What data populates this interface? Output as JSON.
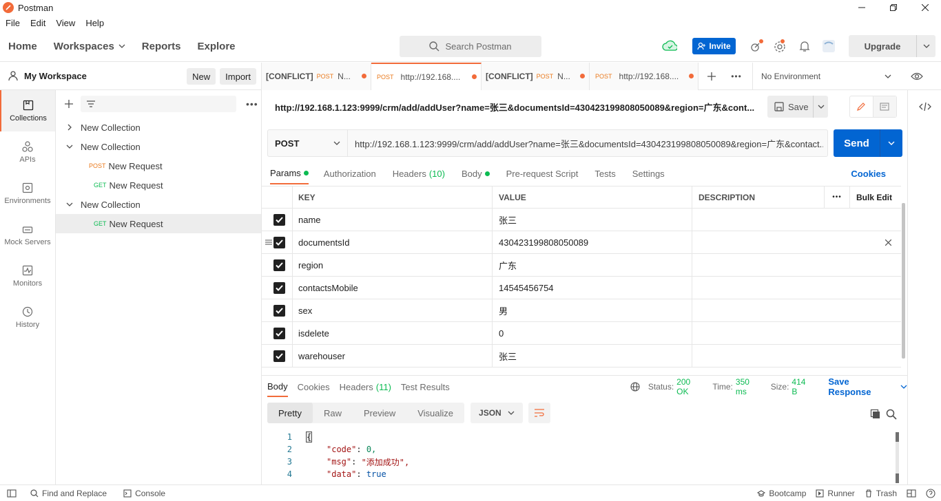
{
  "window": {
    "title": "Postman"
  },
  "menu": [
    "File",
    "Edit",
    "View",
    "Help"
  ],
  "header": {
    "nav": {
      "home": "Home",
      "workspaces": "Workspaces",
      "reports": "Reports",
      "explore": "Explore"
    },
    "search_placeholder": "Search Postman",
    "invite": "Invite",
    "upgrade": "Upgrade"
  },
  "workspace": {
    "name": "My Workspace",
    "new_btn": "New",
    "import_btn": "Import"
  },
  "rail": [
    {
      "label": "Collections",
      "icon": "collections-icon"
    },
    {
      "label": "APIs",
      "icon": "apis-icon"
    },
    {
      "label": "Environments",
      "icon": "environments-icon"
    },
    {
      "label": "Mock Servers",
      "icon": "mock-servers-icon"
    },
    {
      "label": "Monitors",
      "icon": "monitors-icon"
    },
    {
      "label": "History",
      "icon": "history-icon"
    }
  ],
  "tree": {
    "c1": "New Collection",
    "c2": "New Collection",
    "r1_method": "POST",
    "r1_name": "New Request",
    "r2_method": "GET",
    "r2_name": "New Request",
    "c3": "New Collection",
    "r3_method": "GET",
    "r3_name": "New Request"
  },
  "tabs": [
    {
      "prefix": "[CONFLICT]",
      "method": "POST",
      "name": "N..."
    },
    {
      "prefix": "",
      "method": "POST",
      "name": "http://192.168...."
    },
    {
      "prefix": "[CONFLICT]",
      "method": "POST",
      "name": "N..."
    },
    {
      "prefix": "",
      "method": "POST",
      "name": "http://192.168...."
    }
  ],
  "environment": "No Environment",
  "request": {
    "title": "http://192.168.1.123:9999/crm/add/addUser?name=张三&documentsId=430423199808050089&region=广东&cont...",
    "save": "Save",
    "method": "POST",
    "url": "http://192.168.1.123:9999/crm/add/addUser?name=张三&documentsId=430423199808050089&region=广东&contact...",
    "send": "Send"
  },
  "subtabs": {
    "params": "Params",
    "authorization": "Authorization",
    "headers": "Headers",
    "headers_count": "(10)",
    "body": "Body",
    "prerequest": "Pre-request Script",
    "tests": "Tests",
    "settings": "Settings",
    "cookies": "Cookies"
  },
  "params": {
    "headers": {
      "key": "KEY",
      "value": "VALUE",
      "description": "DESCRIPTION",
      "bulk": "Bulk Edit"
    },
    "rows": [
      {
        "key": "name",
        "value": "张三"
      },
      {
        "key": "documentsId",
        "value": "430423199808050089"
      },
      {
        "key": "region",
        "value": "广东"
      },
      {
        "key": "contactsMobile",
        "value": "14545456754"
      },
      {
        "key": "sex",
        "value": "男"
      },
      {
        "key": "isdelete",
        "value": "0"
      },
      {
        "key": "warehouser",
        "value": "张三"
      }
    ]
  },
  "response": {
    "tabs": {
      "body": "Body",
      "cookies": "Cookies",
      "headers": "Headers",
      "headers_count": "(11)",
      "tests": "Test Results"
    },
    "status_label": "Status:",
    "status": "200 OK",
    "time_label": "Time:",
    "time": "350 ms",
    "size_label": "Size:",
    "size": "414 B",
    "save": "Save Response",
    "views": {
      "pretty": "Pretty",
      "raw": "Raw",
      "preview": "Preview",
      "visualize": "Visualize"
    },
    "format": "JSON",
    "lines": [
      {
        "n": "1",
        "k": "",
        "v": "",
        "brace": "{"
      },
      {
        "n": "2",
        "k": "\"code\"",
        "v": "0,"
      },
      {
        "n": "3",
        "k": "\"msg\"",
        "v": "\"添加成功\","
      },
      {
        "n": "4",
        "k": "\"data\"",
        "v": "true"
      }
    ]
  },
  "statusbar": {
    "find": "Find and Replace",
    "console": "Console",
    "bootcamp": "Bootcamp",
    "runner": "Runner",
    "trash": "Trash"
  }
}
